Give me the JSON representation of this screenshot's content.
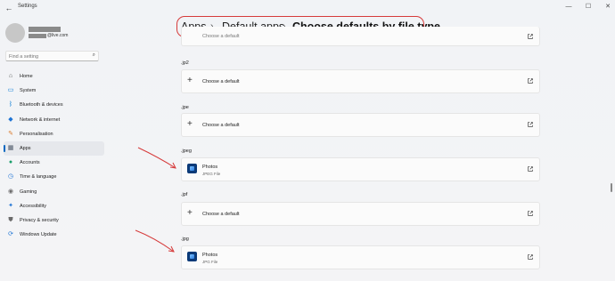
{
  "window": {
    "title": "Settings"
  },
  "profile": {
    "email_domain": "@live.com"
  },
  "search": {
    "placeholder": "Find a setting"
  },
  "sidebar": {
    "items": [
      {
        "label": "Home",
        "icon": "home-icon",
        "glyph": "⌂",
        "color": "#555555"
      },
      {
        "label": "System",
        "icon": "monitor-icon",
        "glyph": "▭",
        "color": "#0078d4"
      },
      {
        "label": "Bluetooth & devices",
        "icon": "bluetooth-icon",
        "glyph": "ᛒ",
        "color": "#0078d4"
      },
      {
        "label": "Network & internet",
        "icon": "wifi-icon",
        "glyph": "◆",
        "color": "#1f74d4"
      },
      {
        "label": "Personalisation",
        "icon": "brush-icon",
        "glyph": "✎",
        "color": "#d97b2b"
      },
      {
        "label": "Apps",
        "icon": "apps-icon",
        "glyph": "▦",
        "color": "#4a5566",
        "active": true
      },
      {
        "label": "Accounts",
        "icon": "person-icon",
        "glyph": "●",
        "color": "#1a9e6a"
      },
      {
        "label": "Time & language",
        "icon": "globe-clock-icon",
        "glyph": "◷",
        "color": "#1f74d4"
      },
      {
        "label": "Gaming",
        "icon": "controller-icon",
        "glyph": "◉",
        "color": "#6b6b6b"
      },
      {
        "label": "Accessibility",
        "icon": "accessibility-icon",
        "glyph": "✦",
        "color": "#1f74d4"
      },
      {
        "label": "Privacy & security",
        "icon": "shield-icon",
        "glyph": "⛊",
        "color": "#6b6b6b"
      },
      {
        "label": "Windows Update",
        "icon": "update-icon",
        "glyph": "⟳",
        "color": "#1f74d4"
      }
    ]
  },
  "breadcrumb": {
    "items": [
      "Apps",
      "Default apps",
      "Choose defaults by file type"
    ]
  },
  "content": {
    "partial_row_label": "Choose a default",
    "entries": [
      {
        "ext": ".jp2",
        "type": "choose",
        "label": "Choose a default"
      },
      {
        "ext": ".jpe",
        "type": "choose",
        "label": "Choose a default"
      },
      {
        "ext": ".jpeg",
        "type": "app",
        "app": "Photos",
        "sub": "JPEG File"
      },
      {
        "ext": ".jpf",
        "type": "choose",
        "label": "Choose a default"
      },
      {
        "ext": ".jpg",
        "type": "app",
        "app": "Photos",
        "sub": "JPG File"
      }
    ]
  },
  "colors": {
    "accent": "#0067c0",
    "annotation": "#d63a3a"
  }
}
